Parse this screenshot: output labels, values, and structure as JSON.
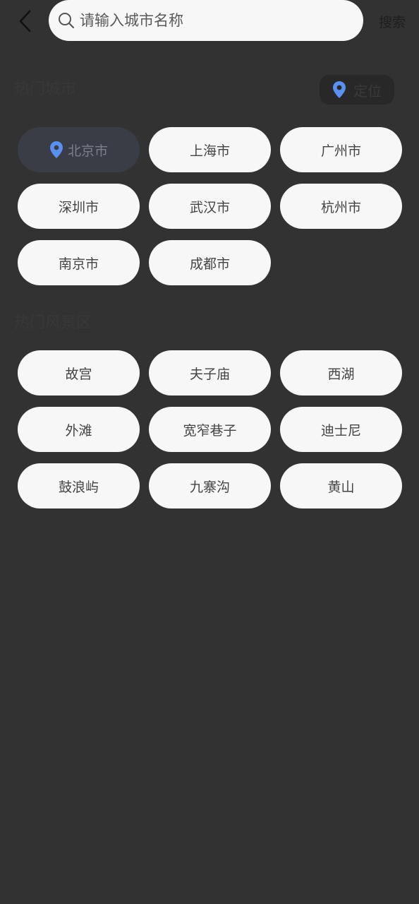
{
  "header": {
    "search_placeholder": "请输入城市名称",
    "search_label": "搜索"
  },
  "hot_cities": {
    "title": "热门城市",
    "locate_label": "定位",
    "items": [
      {
        "label": "北京市",
        "current": true
      },
      {
        "label": "上海市",
        "current": false
      },
      {
        "label": "广州市",
        "current": false
      },
      {
        "label": "深圳市",
        "current": false
      },
      {
        "label": "武汉市",
        "current": false
      },
      {
        "label": "杭州市",
        "current": false
      },
      {
        "label": "南京市",
        "current": false
      },
      {
        "label": "成都市",
        "current": false
      }
    ]
  },
  "hot_scenic": {
    "title": "热门风景区",
    "items": [
      {
        "label": "故宫"
      },
      {
        "label": "夫子庙"
      },
      {
        "label": "西湖"
      },
      {
        "label": "外滩"
      },
      {
        "label": "宽窄巷子"
      },
      {
        "label": "迪士尼"
      },
      {
        "label": "鼓浪屿"
      },
      {
        "label": "九寨沟"
      },
      {
        "label": "黄山"
      }
    ]
  },
  "colors": {
    "background": "#323232",
    "chip": "#f7f7f7",
    "accent_pin": "#5b8ff0"
  },
  "icons": {
    "back": "chevron-left-icon",
    "search": "search-icon",
    "location": "location-pin-icon"
  }
}
